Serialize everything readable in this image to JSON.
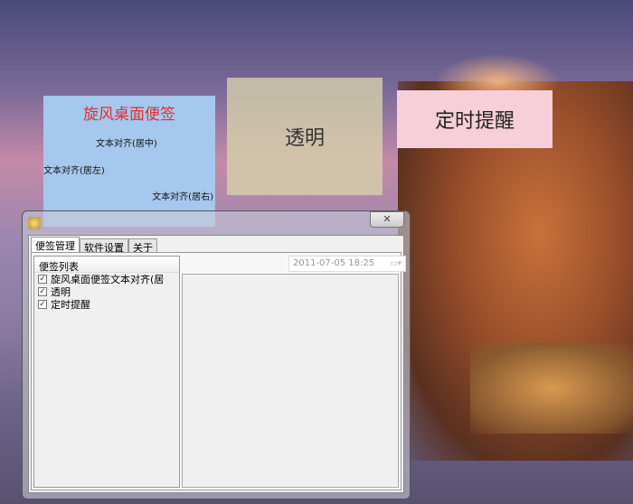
{
  "notes": {
    "note1": {
      "title": "旋风桌面便签",
      "center": "文本对齐(居中)",
      "left": "文本对齐(居左)",
      "right": "文本对齐(居右)"
    },
    "note2": {
      "text": "透明"
    },
    "note3": {
      "text": "定时提醒"
    }
  },
  "window": {
    "close": "✕",
    "tabs": [
      "便签管理",
      "软件设置",
      "关于"
    ],
    "list_header": "便签列表",
    "items": [
      {
        "label": "旋风桌面便签文本对齐(居",
        "checked": true
      },
      {
        "label": "透明",
        "checked": true
      },
      {
        "label": "定时提醒",
        "checked": true
      }
    ],
    "datetime": "2011-07-05  18:25"
  }
}
